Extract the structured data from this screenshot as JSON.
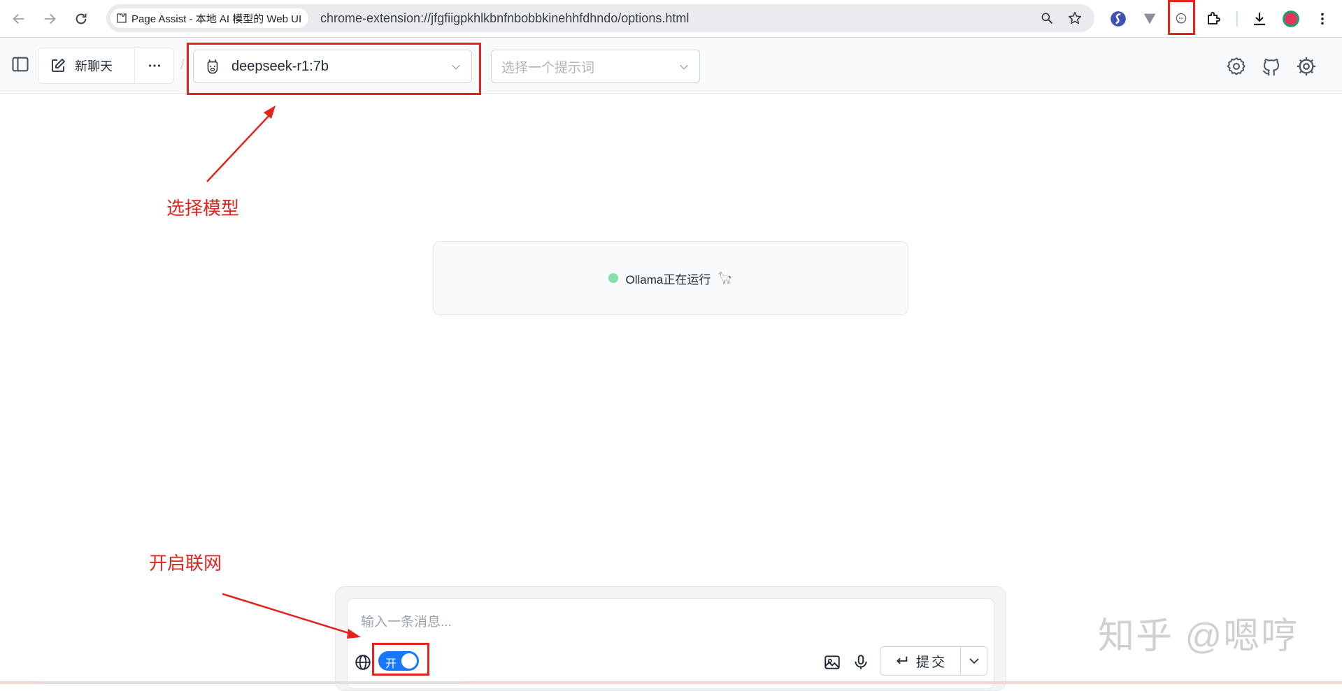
{
  "browser": {
    "tab_title": "Page Assist - 本地 AI 模型的 Web UI",
    "url": "chrome-extension://jfgfiigpkhlkbnfnbobbkinehhfdhndo/options.html",
    "accent_avatar_color": "#e8345a"
  },
  "header": {
    "new_chat_label": "新聊天",
    "separator": "/",
    "model_name": "deepseek-r1:7b",
    "prompt_placeholder": "选择一个提示词"
  },
  "status": {
    "text": "Ollama正在运行",
    "emoji": "🦙",
    "dot_color": "#86dfa6"
  },
  "composer": {
    "placeholder": "输入一条消息...",
    "web_toggle_label": "开",
    "web_toggle_on": true,
    "submit_label": "提交"
  },
  "annotations": {
    "select_model": "选择模型",
    "enable_web": "开启联网",
    "color": "#e1251b"
  },
  "watermark": "知乎 @嗯哼"
}
